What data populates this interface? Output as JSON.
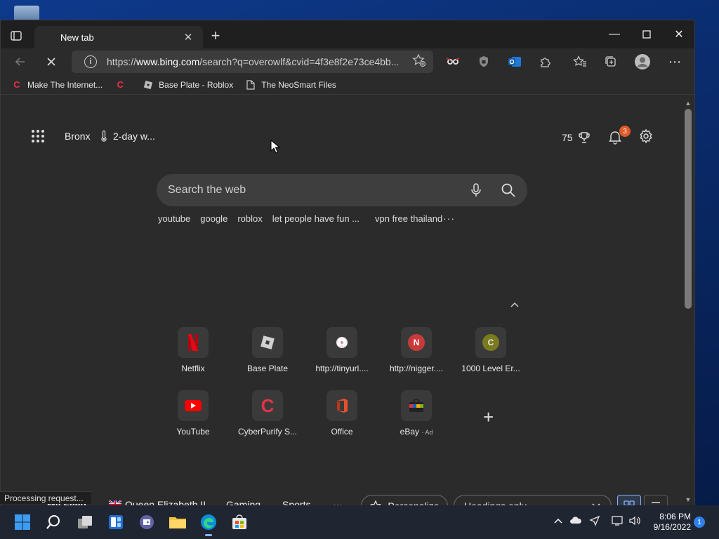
{
  "browser": {
    "tab_title": "New tab",
    "url_prefix": "https://",
    "url_domain": "www.bing.com",
    "url_rest": "/search?q=overowlf&cvid=4f3e8f2e73ce4bb...",
    "favorites": [
      {
        "label": "Make The Internet...",
        "icon": "cyberpurify-icon"
      },
      {
        "label": "",
        "icon": "cyberpurify-icon"
      },
      {
        "label": "Base Plate - Roblox",
        "icon": "roblox-icon"
      },
      {
        "label": "The NeoSmart Files",
        "icon": "page-icon"
      }
    ]
  },
  "newtab": {
    "location": "Bronx",
    "weather": "2-day w...",
    "rewards_points": "75",
    "notification_count": "3",
    "search_placeholder": "Search the web",
    "trending": [
      "youtube",
      "google",
      "roblox",
      "let people have fun ...",
      "vpn free thailand"
    ],
    "more": "···",
    "quick_links": [
      {
        "label": "Netflix",
        "icon": "netflix-icon"
      },
      {
        "label": "Base Plate",
        "icon": "roblox-icon"
      },
      {
        "label": "http://tinyurl....",
        "icon": "tinyurl-icon"
      },
      {
        "label": "http://nigger....",
        "icon": "letter-n-icon",
        "letter": "N"
      },
      {
        "label": "1000 Level Er...",
        "icon": "letter-c-icon",
        "letter": "C"
      },
      {
        "label": "YouTube",
        "icon": "youtube-icon"
      },
      {
        "label": "CyberPurify S...",
        "icon": "cyberpurify-icon"
      },
      {
        "label": "Office",
        "icon": "office-icon"
      },
      {
        "label": "eBay",
        "icon": "ebay-icon",
        "ad": "· Ad"
      }
    ]
  },
  "feed": {
    "items": [
      "My Feed",
      "Queen Elizabeth II",
      "Gaming",
      "Sports"
    ],
    "more": "···",
    "personalize": "Personalize",
    "view_select": "Headings only"
  },
  "status_text": "Processing request...",
  "taskbar": {
    "time": "8:06 PM",
    "date": "9/16/2022",
    "notifications": "1"
  },
  "colors": {
    "accent": "#8ab4f8",
    "badge": "#e05a2a",
    "page_bg": "#2b2b2b"
  }
}
